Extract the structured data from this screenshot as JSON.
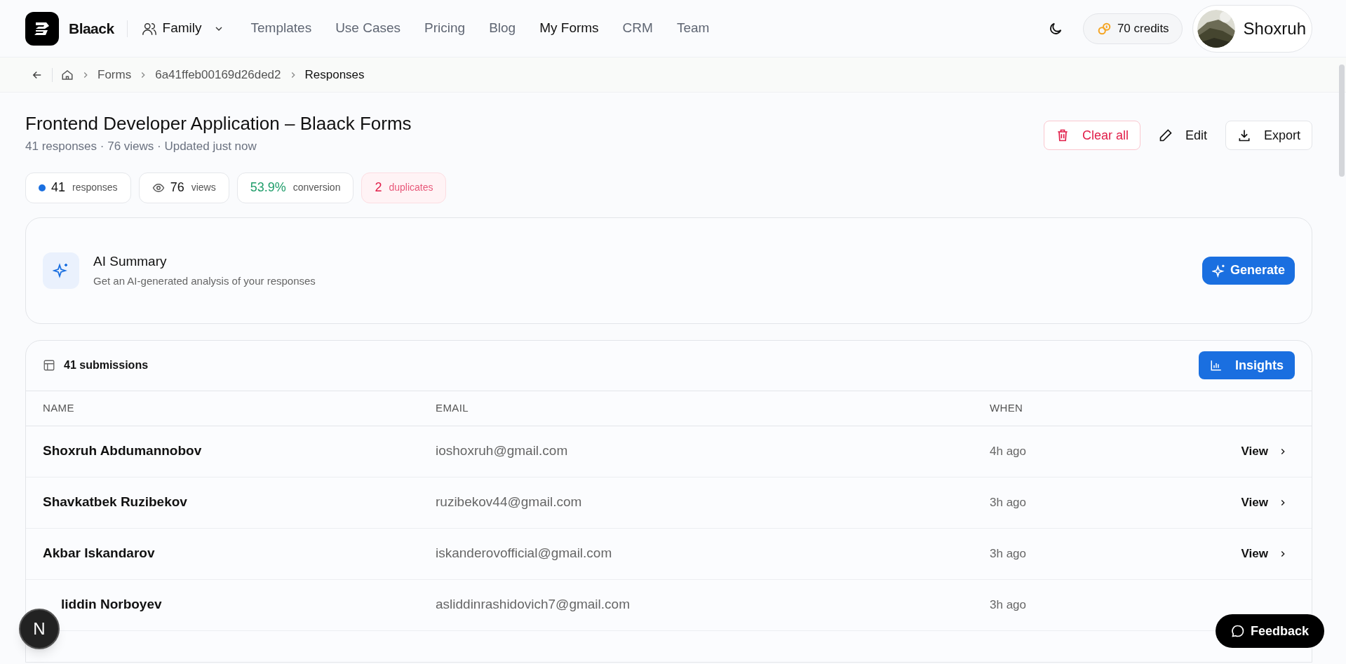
{
  "brand": {
    "name": "Blaack"
  },
  "workspace": {
    "label": "Family"
  },
  "nav": [
    {
      "label": "Templates",
      "selected": false
    },
    {
      "label": "Use Cases",
      "selected": false
    },
    {
      "label": "Pricing",
      "selected": false
    },
    {
      "label": "Blog",
      "selected": false
    },
    {
      "label": "My Forms",
      "selected": true
    },
    {
      "label": "CRM",
      "selected": false
    },
    {
      "label": "Team",
      "selected": false
    }
  ],
  "credits": "70 credits",
  "user": {
    "name": "Shoxruh"
  },
  "breadcrumb": [
    "Forms",
    "6a41ffeb00169d26ded2",
    "Responses"
  ],
  "form": {
    "title": "Frontend Developer Application – Blaack Forms",
    "subtitle": "41 responses · 76 views · Updated just now"
  },
  "actions": [
    {
      "kind": "danger",
      "label": "Clear all"
    },
    {
      "kind": "plain",
      "label": "Edit"
    },
    {
      "kind": "outline",
      "label": "Export"
    }
  ],
  "stats": [
    {
      "kind": "dot",
      "value": "41",
      "label": "responses",
      "color": "#1a6fe0"
    },
    {
      "kind": "eye",
      "value": "76",
      "label": "views"
    },
    {
      "kind": "good",
      "value": "53.9%",
      "label": "conversion"
    },
    {
      "kind": "bad",
      "value": "2",
      "label": "duplicates"
    }
  ],
  "ai_summary": {
    "title": "AI Summary",
    "description": "Get an AI-generated analysis of your responses",
    "button": "Generate"
  },
  "submissions": {
    "title": "41 submissions",
    "button": "Insights",
    "columns": [
      "NAME",
      "EMAIL",
      "WHEN"
    ],
    "rows": [
      {
        "name": "Shoxruh Abdumannobov",
        "partly_hidden": false,
        "email": "ioshoxruh@gmail.com",
        "when": "4h ago",
        "action": "View"
      },
      {
        "name": "Shavkatbek Ruzibekov",
        "partly_hidden": false,
        "email": "ruzibekov44@gmail.com",
        "when": "3h ago",
        "action": "View"
      },
      {
        "name": "Akbar Iskandarov",
        "partly_hidden": false,
        "email": "iskanderovofficial@gmail.com",
        "when": "3h ago",
        "action": "View"
      },
      {
        "name": "liddin Norboyev",
        "partly_hidden": true,
        "email": "asliddinrashidovich7@gmail.com",
        "when": "3h ago"
      }
    ]
  },
  "floating": {
    "badge": "N",
    "feedback": "Feedback"
  }
}
